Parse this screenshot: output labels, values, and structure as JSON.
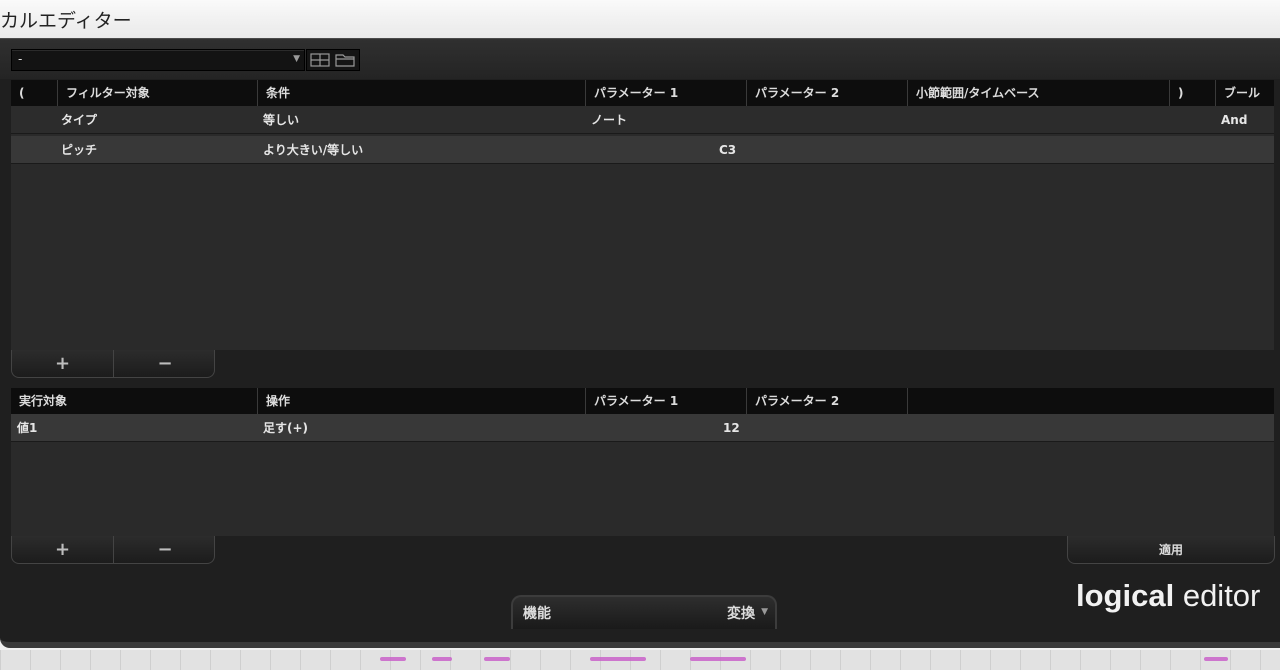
{
  "window": {
    "title": "カルエディター"
  },
  "toolbar": {
    "preset_value": "-"
  },
  "filter": {
    "headers": [
      "(",
      "フィルター対象",
      "条件",
      "パラメーター 1",
      "パラメーター 2",
      "小節範囲/タイムベース",
      ")",
      "ブール"
    ],
    "rows": [
      {
        "target": "タイプ",
        "condition": "等しい",
        "param1": "ノート",
        "param2": "",
        "bool": "And"
      },
      {
        "target": "ピッチ",
        "condition": "より大きい/等しい",
        "param1": "C3",
        "param2": "",
        "bool": ""
      }
    ],
    "add_label": "+",
    "remove_label": "−"
  },
  "action": {
    "headers": [
      "実行対象",
      "操作",
      "パラメーター 1",
      "パラメーター 2"
    ],
    "rows": [
      {
        "target": "値1",
        "operation": "足す(+)",
        "param1": "12",
        "param2": ""
      }
    ],
    "add_label": "+",
    "remove_label": "−"
  },
  "apply_label": "適用",
  "function": {
    "label": "機能",
    "value": "変換"
  },
  "brand": {
    "bold": "logical",
    "light": "editor"
  },
  "colors": {
    "background": "#1f1f1f",
    "header": "#0d0d0d",
    "row_alt": "#383838",
    "midi_note": "#c85ac8"
  }
}
